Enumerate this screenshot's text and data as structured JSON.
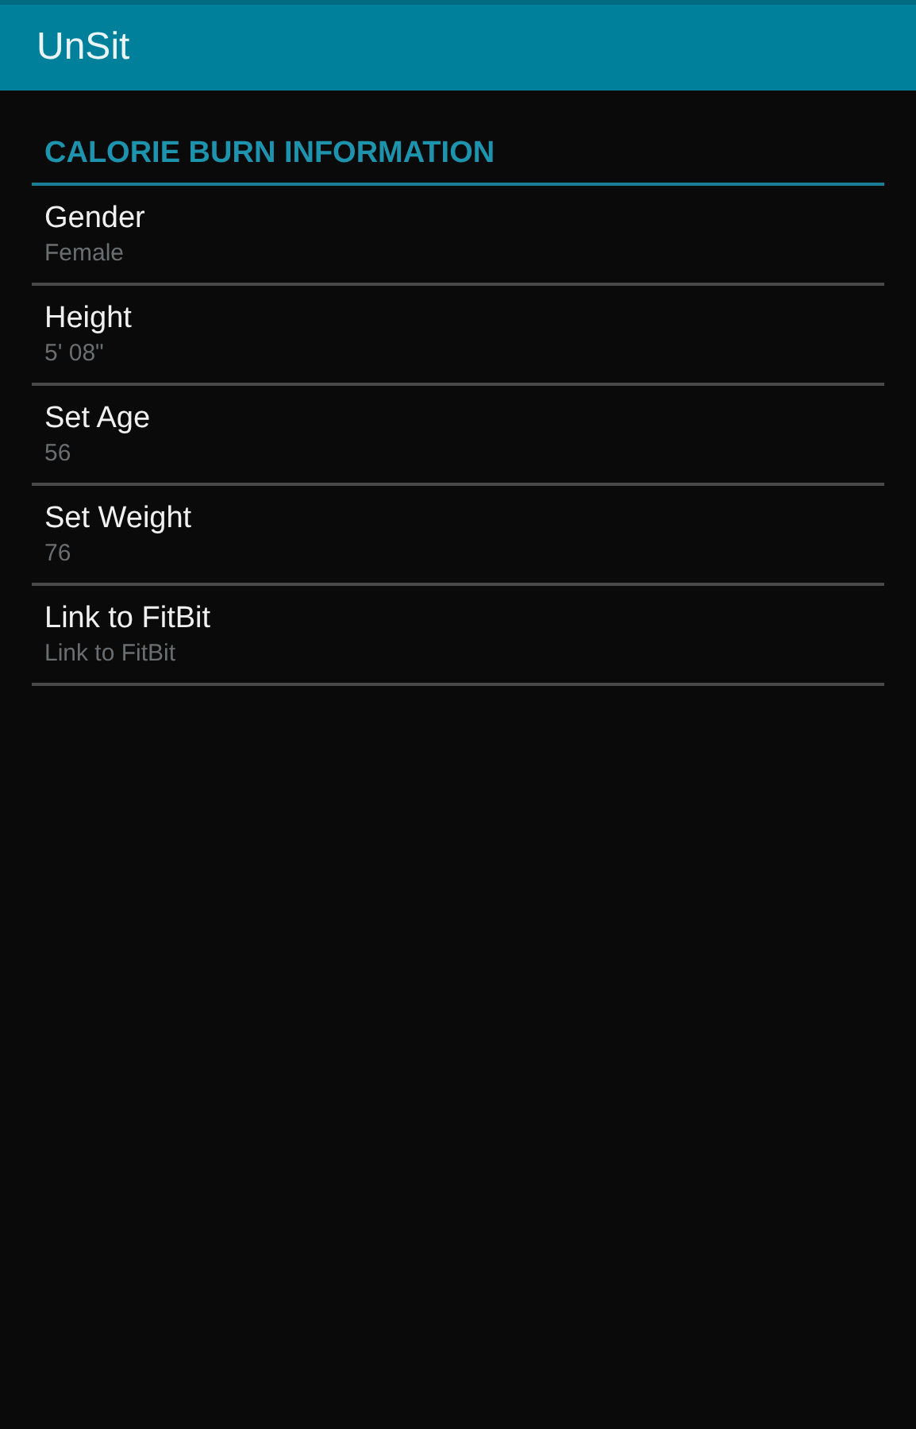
{
  "action_bar": {
    "title": "UnSit"
  },
  "category": {
    "title": "CALORIE BURN INFORMATION"
  },
  "preferences": [
    {
      "title": "Gender",
      "summary": "Female"
    },
    {
      "title": "Height",
      "summary": "5' 08\""
    },
    {
      "title": "Set Age",
      "summary": "56"
    },
    {
      "title": "Set Weight",
      "summary": "76"
    },
    {
      "title": "Link to FitBit",
      "summary": "Link to FitBit"
    }
  ]
}
